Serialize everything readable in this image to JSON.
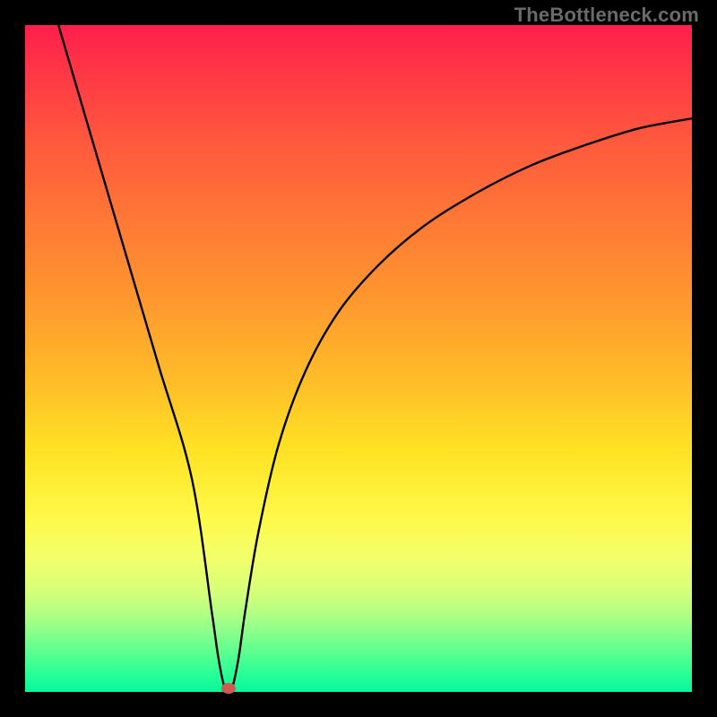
{
  "watermark": "TheBottleneck.com",
  "chart_data": {
    "type": "line",
    "title": "",
    "xlabel": "",
    "ylabel": "",
    "xlim": [
      0,
      100
    ],
    "ylim": [
      0,
      100
    ],
    "grid": false,
    "series": [
      {
        "name": "curve",
        "x": [
          5,
          10,
          15,
          20,
          25,
          28,
          29,
          30,
          31,
          32,
          33,
          35,
          38,
          42,
          47,
          53,
          60,
          68,
          76,
          84,
          92,
          100
        ],
        "y": [
          100,
          83,
          66,
          49,
          32,
          12,
          5,
          0.5,
          0.5,
          5,
          12,
          24,
          37,
          48,
          57,
          64,
          70,
          75,
          79,
          82,
          84.5,
          86
        ]
      }
    ],
    "marker": {
      "x": 30.5,
      "y": 0.6,
      "color": "#cf5a52"
    },
    "background": {
      "gradient_top": "#ff1e4c",
      "gradient_bottom": "#07f79d"
    }
  }
}
